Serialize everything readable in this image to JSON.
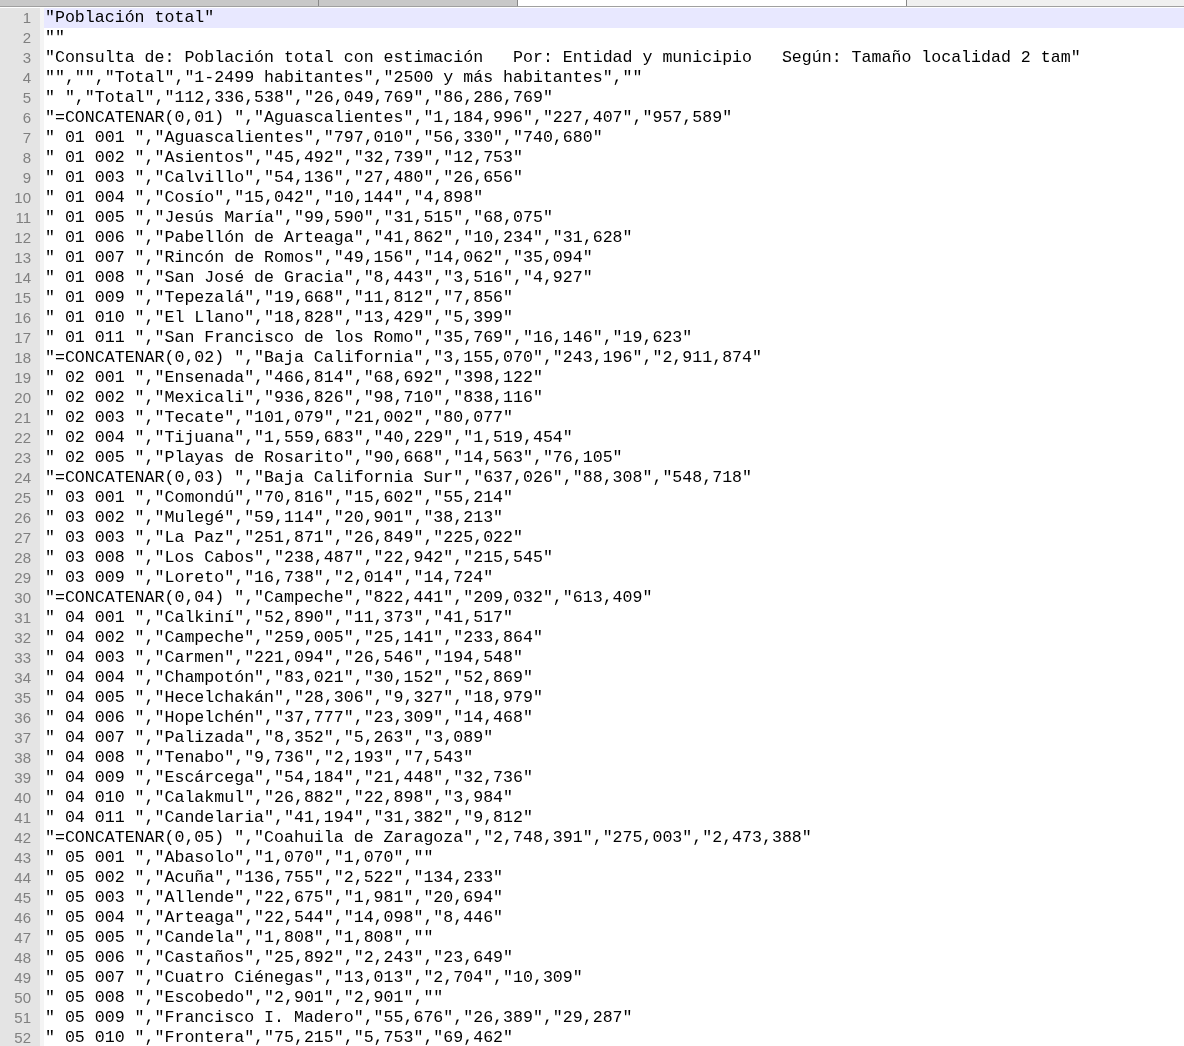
{
  "tabs": [
    {
      "selected": false
    },
    {
      "selected": false
    },
    {
      "selected": true
    }
  ],
  "lines": [
    {
      "number": "1",
      "text": "\"Población total\"",
      "selected": true
    },
    {
      "number": "2",
      "text": "\"\"",
      "selected": false
    },
    {
      "number": "3",
      "text": "\"Consulta de: Población total con estimación   Por: Entidad y municipio   Según: Tamaño localidad 2 tam\"",
      "selected": false
    },
    {
      "number": "4",
      "text": "\"\",\"\",\"Total\",\"1-2499 habitantes\",\"2500 y más habitantes\",\"\"",
      "selected": false
    },
    {
      "number": "5",
      "text": "\" \",\"Total\",\"112,336,538\",\"26,049,769\",\"86,286,769\"",
      "selected": false
    },
    {
      "number": "6",
      "text": "\"=CONCATENAR(0,01) \",\"Aguascalientes\",\"1,184,996\",\"227,407\",\"957,589\"",
      "selected": false
    },
    {
      "number": "7",
      "text": "\" 01 001 \",\"Aguascalientes\",\"797,010\",\"56,330\",\"740,680\"",
      "selected": false
    },
    {
      "number": "8",
      "text": "\" 01 002 \",\"Asientos\",\"45,492\",\"32,739\",\"12,753\"",
      "selected": false
    },
    {
      "number": "9",
      "text": "\" 01 003 \",\"Calvillo\",\"54,136\",\"27,480\",\"26,656\"",
      "selected": false
    },
    {
      "number": "10",
      "text": "\" 01 004 \",\"Cosío\",\"15,042\",\"10,144\",\"4,898\"",
      "selected": false
    },
    {
      "number": "11",
      "text": "\" 01 005 \",\"Jesús María\",\"99,590\",\"31,515\",\"68,075\"",
      "selected": false
    },
    {
      "number": "12",
      "text": "\" 01 006 \",\"Pabellón de Arteaga\",\"41,862\",\"10,234\",\"31,628\"",
      "selected": false
    },
    {
      "number": "13",
      "text": "\" 01 007 \",\"Rincón de Romos\",\"49,156\",\"14,062\",\"35,094\"",
      "selected": false
    },
    {
      "number": "14",
      "text": "\" 01 008 \",\"San José de Gracia\",\"8,443\",\"3,516\",\"4,927\"",
      "selected": false
    },
    {
      "number": "15",
      "text": "\" 01 009 \",\"Tepezalá\",\"19,668\",\"11,812\",\"7,856\"",
      "selected": false
    },
    {
      "number": "16",
      "text": "\" 01 010 \",\"El Llano\",\"18,828\",\"13,429\",\"5,399\"",
      "selected": false
    },
    {
      "number": "17",
      "text": "\" 01 011 \",\"San Francisco de los Romo\",\"35,769\",\"16,146\",\"19,623\"",
      "selected": false
    },
    {
      "number": "18",
      "text": "\"=CONCATENAR(0,02) \",\"Baja California\",\"3,155,070\",\"243,196\",\"2,911,874\"",
      "selected": false
    },
    {
      "number": "19",
      "text": "\" 02 001 \",\"Ensenada\",\"466,814\",\"68,692\",\"398,122\"",
      "selected": false
    },
    {
      "number": "20",
      "text": "\" 02 002 \",\"Mexicali\",\"936,826\",\"98,710\",\"838,116\"",
      "selected": false
    },
    {
      "number": "21",
      "text": "\" 02 003 \",\"Tecate\",\"101,079\",\"21,002\",\"80,077\"",
      "selected": false
    },
    {
      "number": "22",
      "text": "\" 02 004 \",\"Tijuana\",\"1,559,683\",\"40,229\",\"1,519,454\"",
      "selected": false
    },
    {
      "number": "23",
      "text": "\" 02 005 \",\"Playas de Rosarito\",\"90,668\",\"14,563\",\"76,105\"",
      "selected": false
    },
    {
      "number": "24",
      "text": "\"=CONCATENAR(0,03) \",\"Baja California Sur\",\"637,026\",\"88,308\",\"548,718\"",
      "selected": false
    },
    {
      "number": "25",
      "text": "\" 03 001 \",\"Comondú\",\"70,816\",\"15,602\",\"55,214\"",
      "selected": false
    },
    {
      "number": "26",
      "text": "\" 03 002 \",\"Mulegé\",\"59,114\",\"20,901\",\"38,213\"",
      "selected": false
    },
    {
      "number": "27",
      "text": "\" 03 003 \",\"La Paz\",\"251,871\",\"26,849\",\"225,022\"",
      "selected": false
    },
    {
      "number": "28",
      "text": "\" 03 008 \",\"Los Cabos\",\"238,487\",\"22,942\",\"215,545\"",
      "selected": false
    },
    {
      "number": "29",
      "text": "\" 03 009 \",\"Loreto\",\"16,738\",\"2,014\",\"14,724\"",
      "selected": false
    },
    {
      "number": "30",
      "text": "\"=CONCATENAR(0,04) \",\"Campeche\",\"822,441\",\"209,032\",\"613,409\"",
      "selected": false
    },
    {
      "number": "31",
      "text": "\" 04 001 \",\"Calkiní\",\"52,890\",\"11,373\",\"41,517\"",
      "selected": false
    },
    {
      "number": "32",
      "text": "\" 04 002 \",\"Campeche\",\"259,005\",\"25,141\",\"233,864\"",
      "selected": false
    },
    {
      "number": "33",
      "text": "\" 04 003 \",\"Carmen\",\"221,094\",\"26,546\",\"194,548\"",
      "selected": false
    },
    {
      "number": "34",
      "text": "\" 04 004 \",\"Champotón\",\"83,021\",\"30,152\",\"52,869\"",
      "selected": false
    },
    {
      "number": "35",
      "text": "\" 04 005 \",\"Hecelchakán\",\"28,306\",\"9,327\",\"18,979\"",
      "selected": false
    },
    {
      "number": "36",
      "text": "\" 04 006 \",\"Hopelchén\",\"37,777\",\"23,309\",\"14,468\"",
      "selected": false
    },
    {
      "number": "37",
      "text": "\" 04 007 \",\"Palizada\",\"8,352\",\"5,263\",\"3,089\"",
      "selected": false
    },
    {
      "number": "38",
      "text": "\" 04 008 \",\"Tenabo\",\"9,736\",\"2,193\",\"7,543\"",
      "selected": false
    },
    {
      "number": "39",
      "text": "\" 04 009 \",\"Escárcega\",\"54,184\",\"21,448\",\"32,736\"",
      "selected": false
    },
    {
      "number": "40",
      "text": "\" 04 010 \",\"Calakmul\",\"26,882\",\"22,898\",\"3,984\"",
      "selected": false
    },
    {
      "number": "41",
      "text": "\" 04 011 \",\"Candelaria\",\"41,194\",\"31,382\",\"9,812\"",
      "selected": false
    },
    {
      "number": "42",
      "text": "\"=CONCATENAR(0,05) \",\"Coahuila de Zaragoza\",\"2,748,391\",\"275,003\",\"2,473,388\"",
      "selected": false
    },
    {
      "number": "43",
      "text": "\" 05 001 \",\"Abasolo\",\"1,070\",\"1,070\",\"\"",
      "selected": false
    },
    {
      "number": "44",
      "text": "\" 05 002 \",\"Acuña\",\"136,755\",\"2,522\",\"134,233\"",
      "selected": false
    },
    {
      "number": "45",
      "text": "\" 05 003 \",\"Allende\",\"22,675\",\"1,981\",\"20,694\"",
      "selected": false
    },
    {
      "number": "46",
      "text": "\" 05 004 \",\"Arteaga\",\"22,544\",\"14,098\",\"8,446\"",
      "selected": false
    },
    {
      "number": "47",
      "text": "\" 05 005 \",\"Candela\",\"1,808\",\"1,808\",\"\"",
      "selected": false
    },
    {
      "number": "48",
      "text": "\" 05 006 \",\"Castaños\",\"25,892\",\"2,243\",\"23,649\"",
      "selected": false
    },
    {
      "number": "49",
      "text": "\" 05 007 \",\"Cuatro Ciénegas\",\"13,013\",\"2,704\",\"10,309\"",
      "selected": false
    },
    {
      "number": "50",
      "text": "\" 05 008 \",\"Escobedo\",\"2,901\",\"2,901\",\"\"",
      "selected": false
    },
    {
      "number": "51",
      "text": "\" 05 009 \",\"Francisco I. Madero\",\"55,676\",\"26,389\",\"29,287\"",
      "selected": false
    },
    {
      "number": "52",
      "text": "\" 05 010 \",\"Frontera\",\"75,215\",\"5,753\",\"69,462\"",
      "selected": false
    }
  ]
}
